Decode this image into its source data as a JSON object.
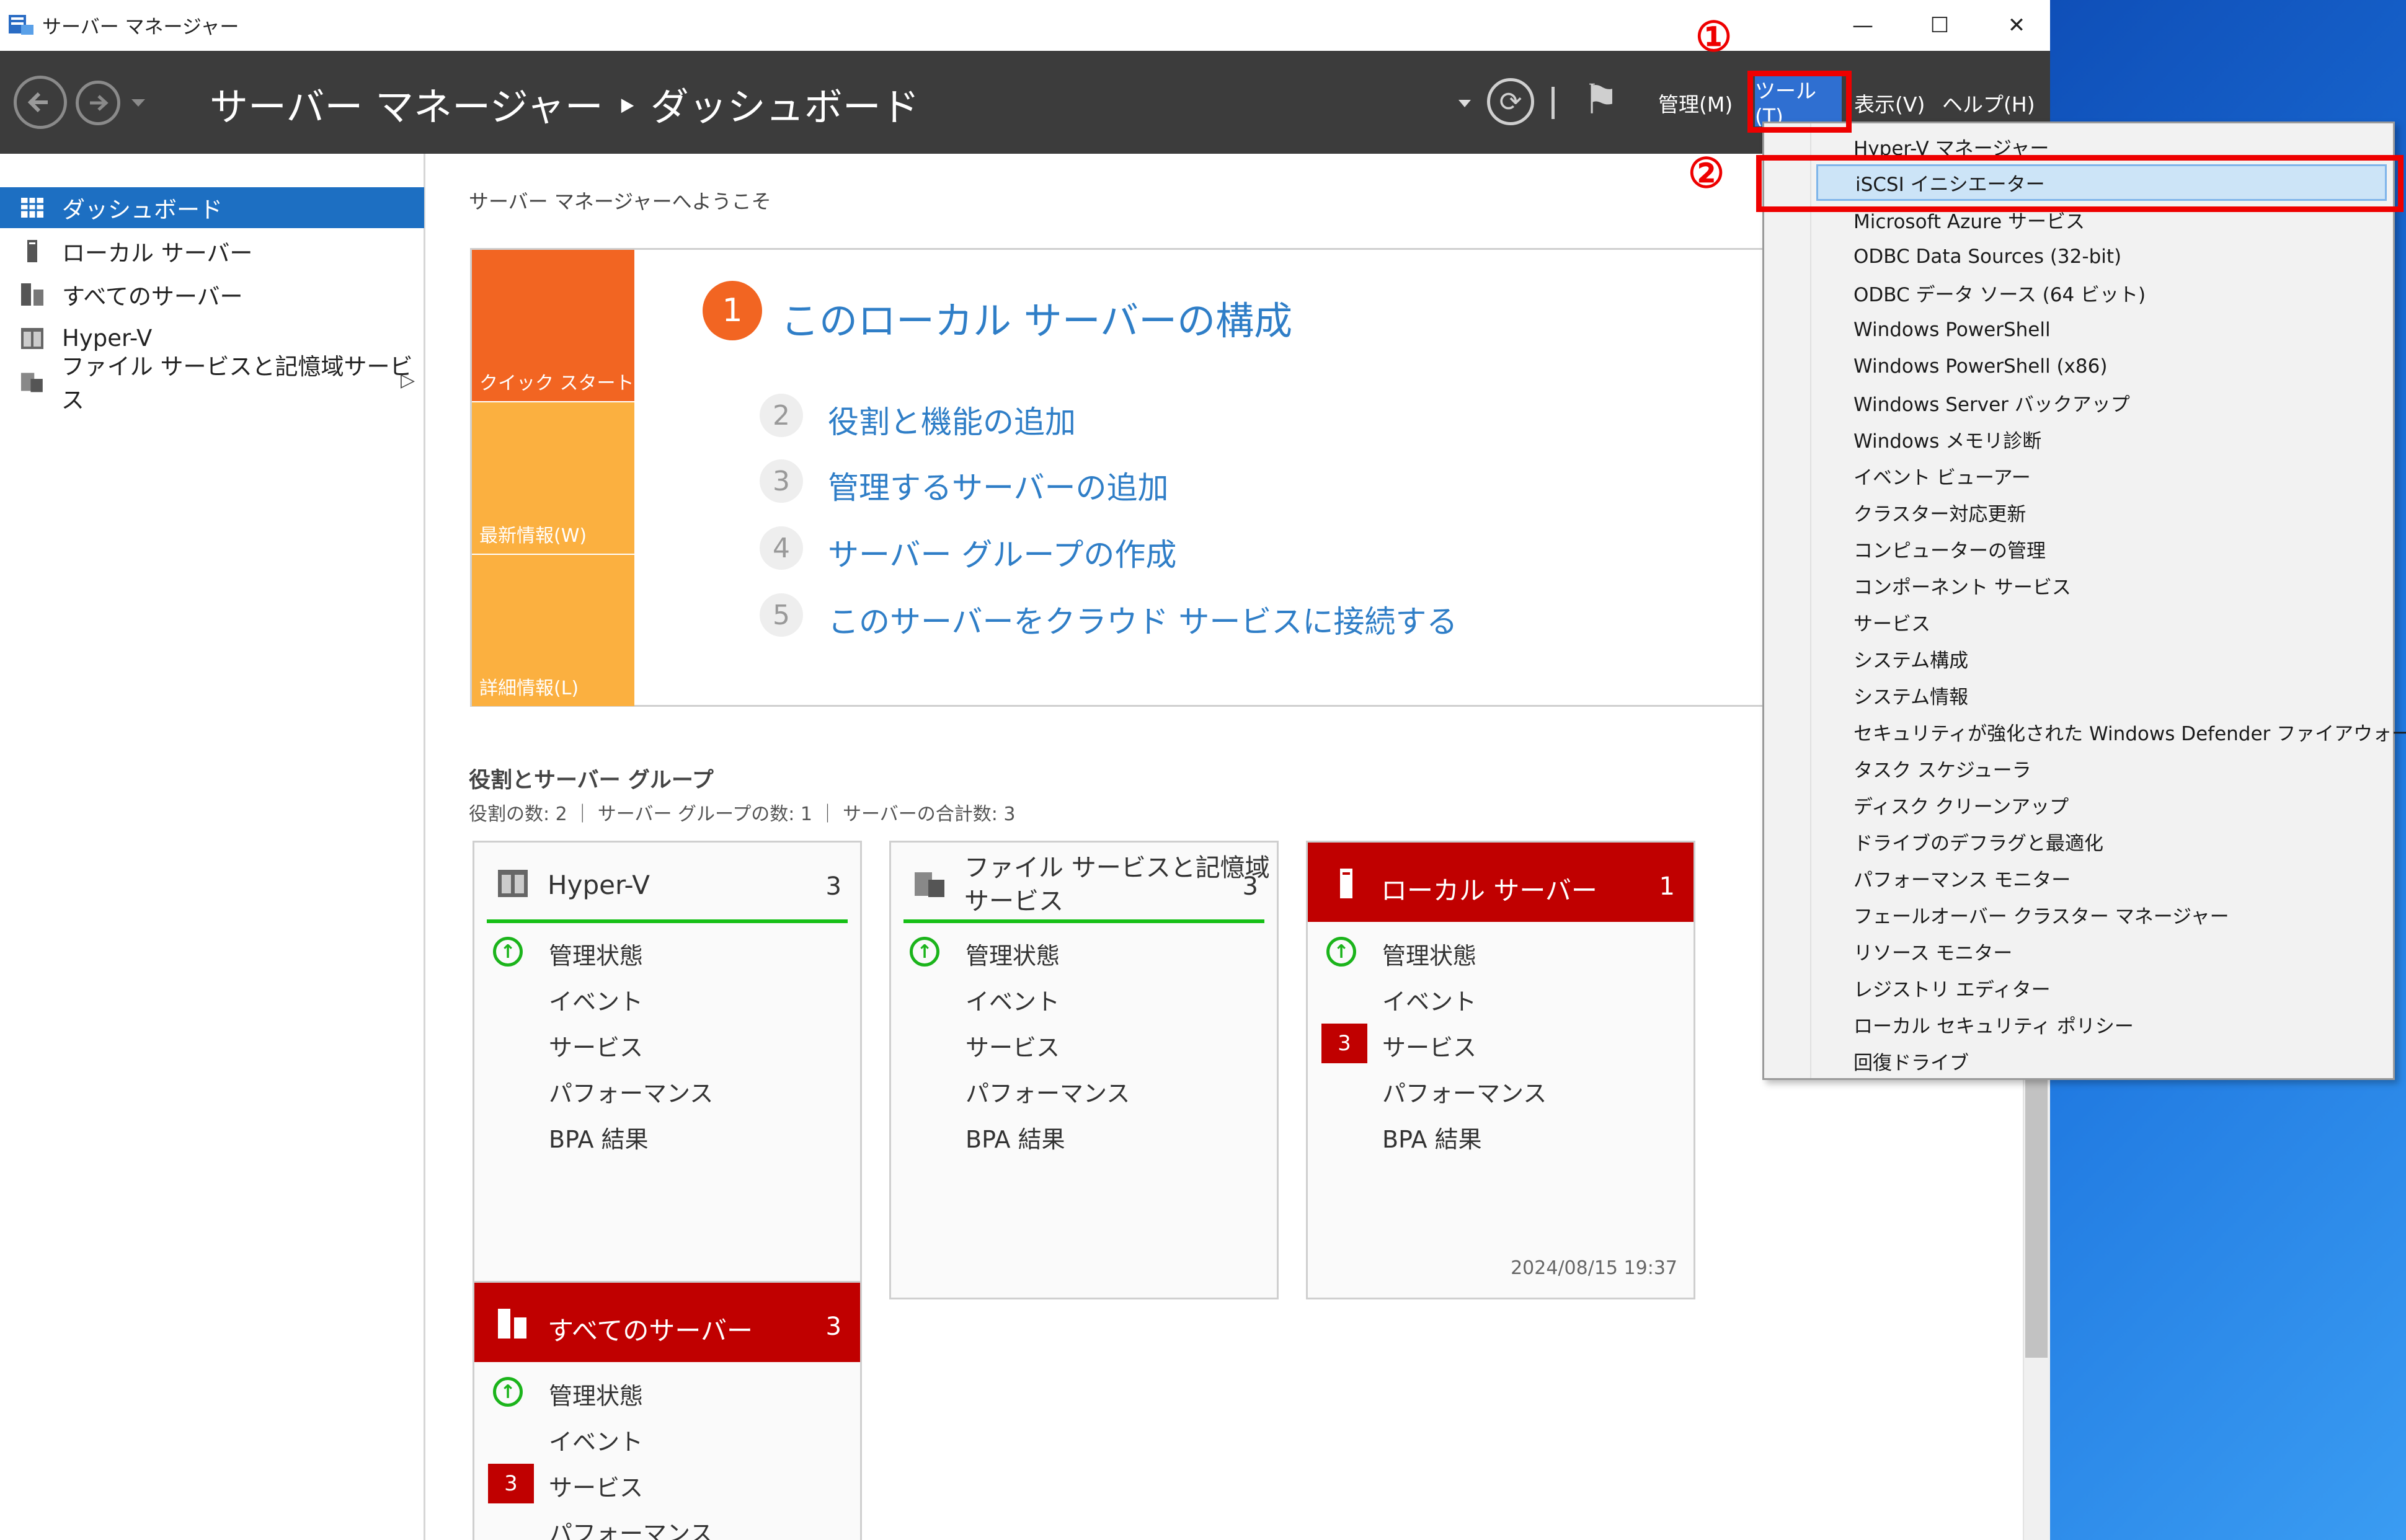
{
  "window": {
    "title": "サーバー マネージャー",
    "min_glyph": "—",
    "max_glyph": "☐",
    "close_glyph": "✕"
  },
  "header": {
    "breadcrumb": "サーバー マネージャー ‣ ダッシュボード",
    "refresh_glyph": "⟳",
    "flag_glyph": "⚑",
    "menus": {
      "manage": "管理(M)",
      "tools": "ツール(T)",
      "view": "表示(V)",
      "help": "ヘルプ(H)"
    }
  },
  "sidebar": {
    "items": [
      {
        "label": "ダッシュボード",
        "icon": "dashboard-icon",
        "selected": true
      },
      {
        "label": "ローカル サーバー",
        "icon": "server-icon"
      },
      {
        "label": "すべてのサーバー",
        "icon": "servers-icon"
      },
      {
        "label": "Hyper-V",
        "icon": "hyperv-icon"
      },
      {
        "label": "ファイル サービスと記憶域サービス",
        "icon": "file-services-icon"
      }
    ],
    "expand_glyph": "▷"
  },
  "main": {
    "welcome": "サーバー マネージャーへようこそ",
    "tiles": [
      {
        "label": "クイック スタート(Q)",
        "color": "#f26522"
      },
      {
        "label": "最新情報(W)",
        "color": "#fbb040"
      },
      {
        "label": "詳細情報(L)",
        "color": "#fbb040"
      }
    ],
    "steps": [
      {
        "num": "1",
        "text": "このローカル サーバーの構成"
      },
      {
        "num": "2",
        "text": "役割と機能の追加"
      },
      {
        "num": "3",
        "text": "管理するサーバーの追加"
      },
      {
        "num": "4",
        "text": "サーバー グループの作成"
      },
      {
        "num": "5",
        "text": "このサーバーをクラウド サービスに接続する"
      }
    ],
    "roles_title": "役割とサーバー グループ",
    "roles_summary": "役割の数: 2 ｜ サーバー グループの数: 1 ｜ サーバーの合計数: 3",
    "cards": [
      {
        "name": "Hyper-V",
        "count": "3",
        "status": "管理状態",
        "events": "イベント",
        "services": "サービス",
        "performance": "パフォーマンス",
        "bpa": "BPA 結果"
      },
      {
        "name_line1": "ファイル サービスと記憶域",
        "name_line2": "サービス",
        "count": "3",
        "status": "管理状態",
        "events": "イベント",
        "services": "サービス",
        "performance": "パフォーマンス",
        "bpa": "BPA 結果"
      },
      {
        "name": "ローカル サーバー",
        "count": "1",
        "status": "管理状態",
        "events": "イベント",
        "services": "サービス",
        "services_badge": "3",
        "performance": "パフォーマンス",
        "bpa": "BPA 結果",
        "timestamp": "2024/08/15 19:37"
      },
      {
        "name": "すべてのサーバー",
        "count": "3",
        "status": "管理状態",
        "events": "イベント",
        "services": "サービス",
        "services_badge": "3",
        "performance": "パフォーマンス"
      }
    ]
  },
  "tools_menu": {
    "items": [
      "Hyper-V マネージャー",
      "iSCSI イニシエーター",
      "Microsoft Azure サービス",
      "ODBC Data Sources (32-bit)",
      "ODBC データ ソース (64 ビット)",
      "Windows PowerShell",
      "Windows PowerShell (x86)",
      "Windows Server バックアップ",
      "Windows メモリ診断",
      "イベント ビューアー",
      "クラスター対応更新",
      "コンピューターの管理",
      "コンポーネント サービス",
      "サービス",
      "システム構成",
      "システム情報",
      "セキュリティが強化された Windows Defender ファイアウォール",
      "タスク スケジューラ",
      "ディスク クリーンアップ",
      "ドライブのデフラグと最適化",
      "パフォーマンス モニター",
      "フェールオーバー クラスター マネージャー",
      "リソース モニター",
      "レジストリ エディター",
      "ローカル セキュリティ ポリシー",
      "回復ドライブ"
    ],
    "highlighted_index": 1
  },
  "annotations": {
    "step1": "①",
    "step2": "②",
    "color": "#ee0000"
  }
}
